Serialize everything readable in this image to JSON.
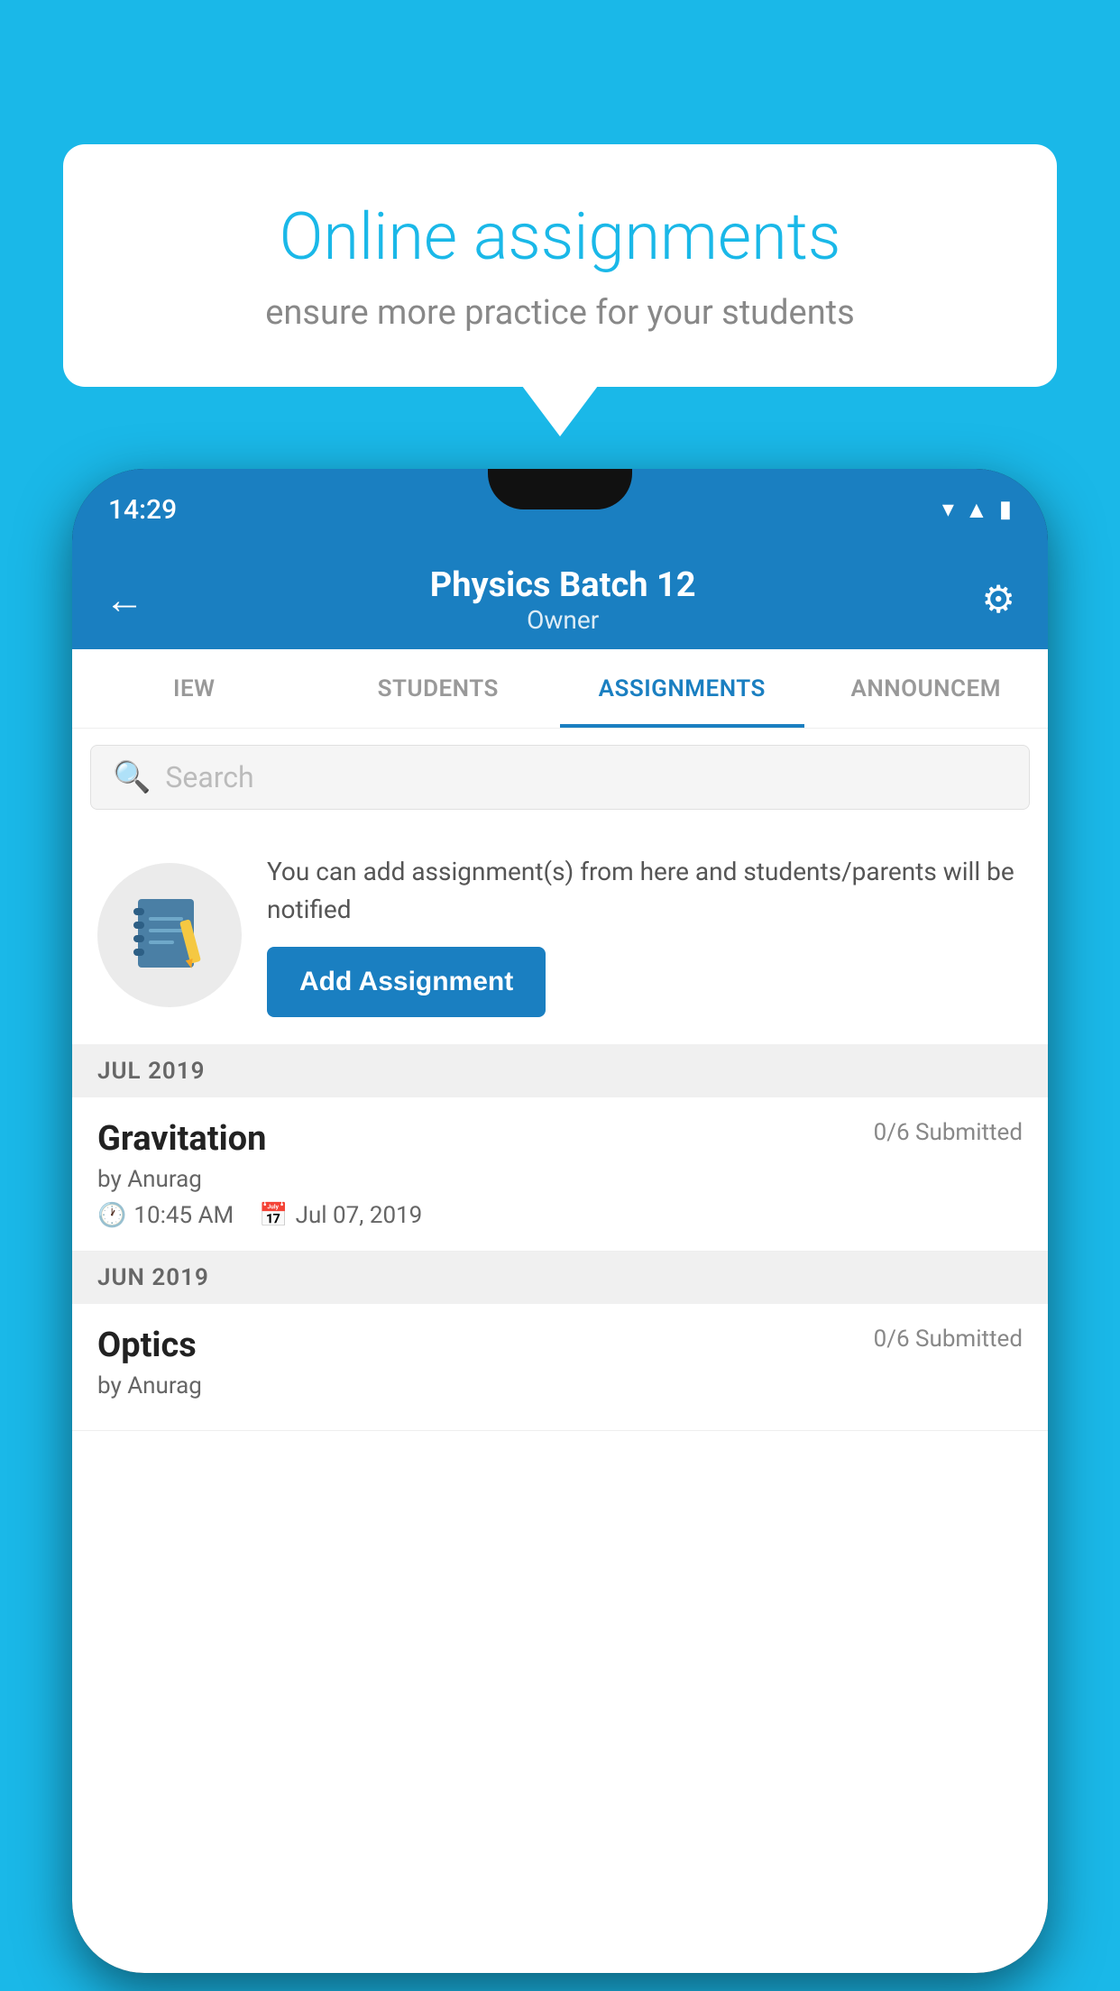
{
  "background_color": "#1ab8e8",
  "speech_bubble": {
    "title": "Online assignments",
    "subtitle": "ensure more practice for your students"
  },
  "phone": {
    "status_bar": {
      "time": "14:29",
      "icons": [
        "wifi",
        "signal",
        "battery"
      ]
    },
    "app_bar": {
      "title": "Physics Batch 12",
      "subtitle": "Owner",
      "back_label": "←",
      "settings_label": "⚙"
    },
    "tabs": [
      {
        "label": "IEW",
        "active": false
      },
      {
        "label": "STUDENTS",
        "active": false
      },
      {
        "label": "ASSIGNMENTS",
        "active": true
      },
      {
        "label": "ANNOUNCEM",
        "active": false
      }
    ],
    "search": {
      "placeholder": "Search"
    },
    "promo": {
      "icon": "📓",
      "text": "You can add assignment(s) from here and students/parents will be notified",
      "button_label": "Add Assignment"
    },
    "sections": [
      {
        "month": "JUL 2019",
        "assignments": [
          {
            "name": "Gravitation",
            "submitted": "0/6 Submitted",
            "by": "by Anurag",
            "time": "10:45 AM",
            "date": "Jul 07, 2019"
          }
        ]
      },
      {
        "month": "JUN 2019",
        "assignments": [
          {
            "name": "Optics",
            "submitted": "0/6 Submitted",
            "by": "by Anurag",
            "time": "",
            "date": ""
          }
        ]
      }
    ]
  }
}
